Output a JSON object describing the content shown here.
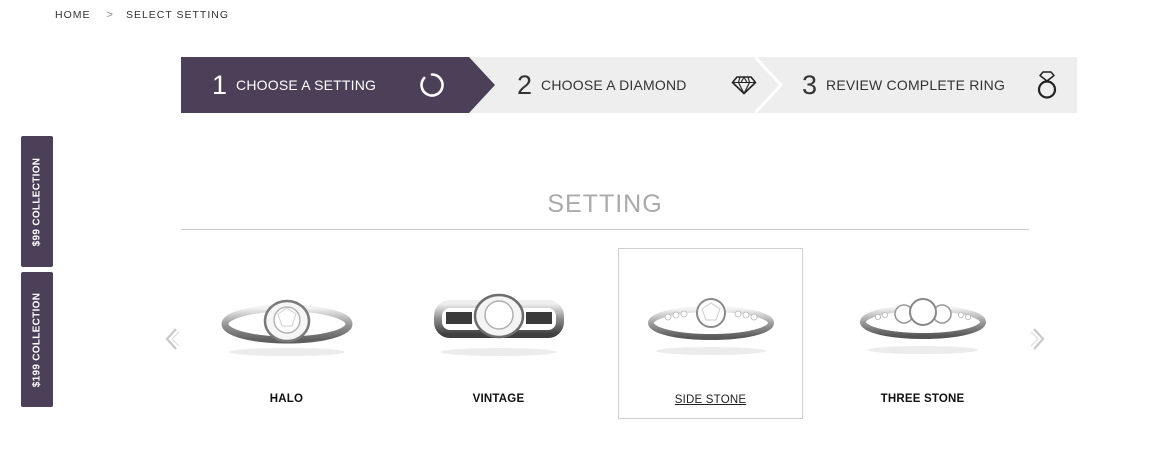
{
  "breadcrumb": {
    "home": "HOME",
    "separator": ">",
    "current": "SELECT SETTING"
  },
  "steps": [
    {
      "number": "1",
      "label": "CHOOSE A SETTING",
      "icon": "ring-progress-icon",
      "active": true
    },
    {
      "number": "2",
      "label": "CHOOSE A DIAMOND",
      "icon": "diamond-icon",
      "active": false
    },
    {
      "number": "3",
      "label": "REVIEW COMPLETE RING",
      "icon": "ring-icon",
      "active": false
    }
  ],
  "side_tabs": [
    {
      "label": "$99 COLLECTION"
    },
    {
      "label": "$199 COLLECTION"
    }
  ],
  "section": {
    "title": "SETTING"
  },
  "settings": [
    {
      "name": "HALO",
      "selected": false,
      "image": "ring-image"
    },
    {
      "name": "VINTAGE",
      "selected": false,
      "image": "ring-image"
    },
    {
      "name": "SIDE STONE",
      "selected": true,
      "image": "ring-image"
    },
    {
      "name": "THREE STONE",
      "selected": false,
      "image": "ring-image"
    }
  ],
  "colors": {
    "brand": "#4c3f58",
    "steps_bg": "#eeeeee",
    "section_title": "#aaaaaa"
  },
  "carousel": {
    "prev_icon": "chevron-left-icon",
    "next_icon": "chevron-right-icon"
  }
}
